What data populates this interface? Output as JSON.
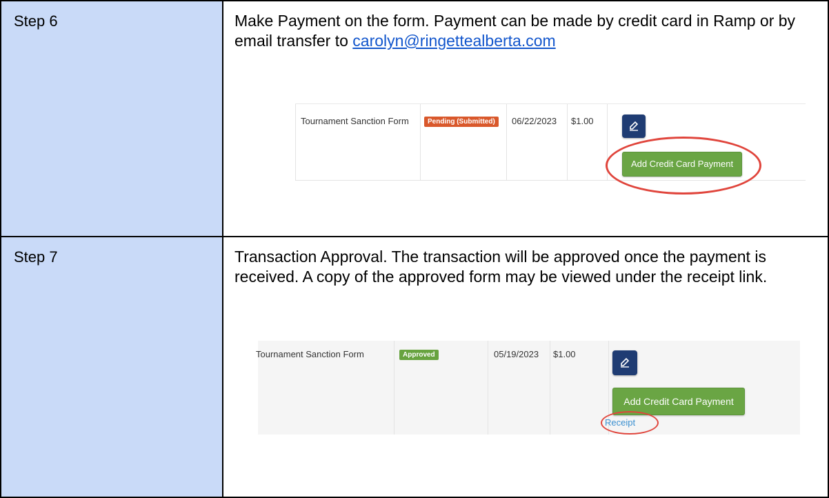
{
  "steps": [
    {
      "label": "Step 6",
      "description": "Make Payment on the form. Payment can be made by credit card in Ramp or by email transfer to ",
      "email": "carolyn@ringettealberta.com",
      "screenshot": {
        "form_name": "Tournament Sanction Form",
        "status": "Pending (Submitted)",
        "status_color": "#d9582b",
        "date": "06/22/2023",
        "amount": "$1.00",
        "button": "Add Credit Card Payment"
      }
    },
    {
      "label": "Step 7",
      "description": "Transaction Approval. The transaction will be approved once the payment is received. A copy of the approved form may be viewed under the receipt link.",
      "screenshot": {
        "form_name": "Tournament Sanction Form",
        "status": "Approved",
        "status_color": "#67a33f",
        "date": "05/19/2023",
        "amount": "$1.00",
        "button": "Add Credit Card Payment",
        "receipt": "Receipt"
      }
    }
  ],
  "colors": {
    "step_background": "#c9daf8",
    "link": "#1155cc",
    "highlight": "#e0453c",
    "button_green": "#6aa544",
    "edit_button": "#1f3c73"
  }
}
